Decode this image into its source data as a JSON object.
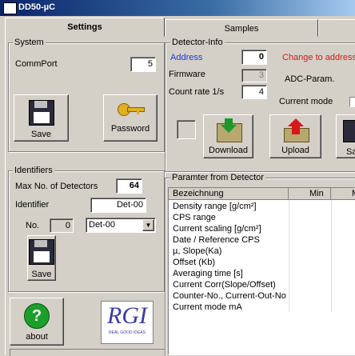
{
  "window": {
    "title": "DD50-µC"
  },
  "tabs": [
    {
      "label": "Settings"
    },
    {
      "label": "Samples"
    }
  ],
  "system": {
    "group_label": "System",
    "commport_label": "CommPort",
    "commport_value": "5",
    "save_label": "Save",
    "password_label": "Password"
  },
  "identifiers": {
    "group_label": "Identifiers",
    "max_detectors_label": "Max No. of Detectors",
    "max_detectors_value": "64",
    "identifier_label": "Identifier",
    "identifier_value": "Det-00",
    "no_label": "No.",
    "no_value": "0",
    "select_value": "Det-00",
    "save_label": "Save"
  },
  "about": {
    "label": "about"
  },
  "logo": {
    "text": "RGI",
    "subtext": "REAL GOOD IDEAS"
  },
  "detector_info": {
    "group_label": "Detector-Info",
    "address_label": "Address",
    "address_value": "0",
    "firmware_label": "Firmware",
    "firmware_value": "3",
    "count_rate_label": "Count rate 1/s",
    "count_rate_value": "4",
    "change_address_label": "Change to address",
    "adc_param_label": "ADC-Param.",
    "current_mode_label": "Current mode",
    "download_label": "Download",
    "upload_label": "Upload",
    "save_label": "Sa"
  },
  "params": {
    "group_label": "Paramter from Detector",
    "columns": [
      "Bezeichnung",
      "Min",
      "M"
    ],
    "rows": [
      "Density  range [g/cm²]",
      "CPS range",
      "Current scaling [g/cm²]",
      "Date / Reference CPS",
      "µ, Slope(Ka)",
      "Offset (Kb)",
      "Averaging time [s]",
      "Current Corr(Slope/Offset)",
      "Counter-No., Current-Out-No",
      "Current mode mA"
    ]
  },
  "colors": {
    "address_label": "#1a3ad8",
    "change_address": "#d81818",
    "title_bar": "#0a246a"
  }
}
